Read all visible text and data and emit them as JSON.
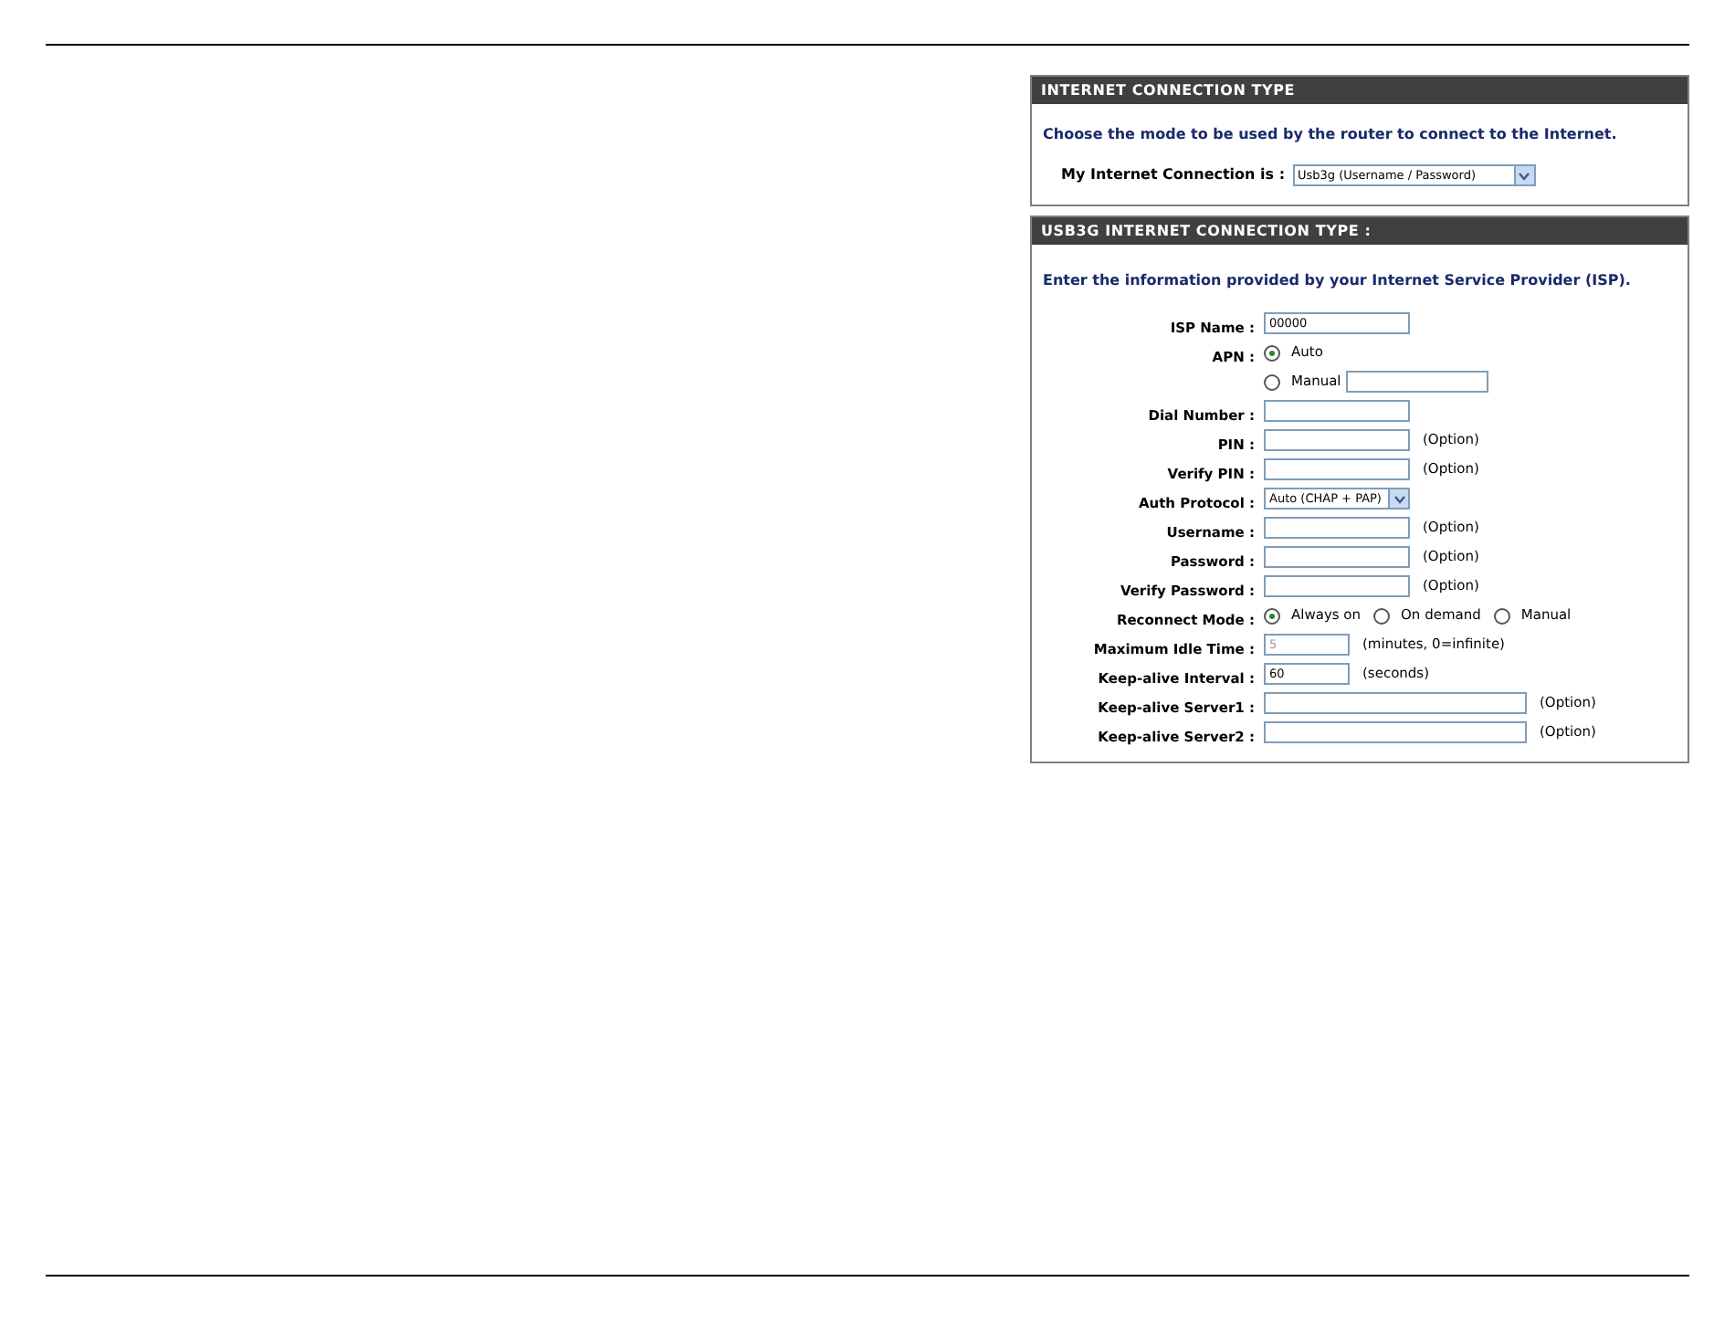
{
  "connection_type": {
    "title": "INTERNET CONNECTION TYPE",
    "description": "Choose the mode to be used by the router to connect to the Internet.",
    "label": "My Internet Connection is :",
    "value": "Usb3g (Username / Password)"
  },
  "usb3g": {
    "title": "USB3G INTERNET CONNECTION TYPE :",
    "description": "Enter the information provided by your Internet Service Provider (ISP).",
    "rows": [
      {
        "kind": "text",
        "label": "ISP Name :",
        "value": "00000",
        "disabled": false
      },
      {
        "kind": "radio",
        "label": "APN :",
        "options": [
          {
            "label": "Auto",
            "selected": true
          }
        ]
      },
      {
        "kind": "radio-text",
        "options": [
          {
            "label": "Manual",
            "selected": false
          }
        ]
      },
      {
        "kind": "text",
        "label": "Dial Number :"
      },
      {
        "kind": "text",
        "label": "PIN :",
        "note": "(Option)"
      },
      {
        "kind": "text",
        "label": "Verify PIN :",
        "note": "(Option)"
      },
      {
        "kind": "select",
        "label": "Auth Protocol :",
        "value": "Auto (CHAP + PAP)"
      },
      {
        "kind": "text",
        "label": "Username :",
        "note": "(Option)"
      },
      {
        "kind": "text",
        "label": "Password :",
        "note": "(Option)"
      },
      {
        "kind": "text",
        "label": "Verify Password :",
        "note": "(Option)"
      },
      {
        "kind": "radio",
        "label": "Reconnect Mode :",
        "options": [
          {
            "label": "Always on",
            "selected": true
          },
          {
            "label": "On demand",
            "selected": false
          },
          {
            "label": "Manual",
            "selected": false
          }
        ]
      },
      {
        "kind": "text-short",
        "label": "Maximum Idle Time :",
        "value": "5",
        "note": "(minutes, 0=infinite)",
        "disabled": true
      },
      {
        "kind": "text-short",
        "label": "Keep-alive Interval :",
        "value": "60",
        "note": "(seconds)",
        "disabled": false
      },
      {
        "kind": "text-long",
        "label": "Keep-alive Server1 :",
        "note": "(Option)"
      },
      {
        "kind": "text-long",
        "label": "Keep-alive Server2 :",
        "note": "(Option)"
      }
    ]
  }
}
